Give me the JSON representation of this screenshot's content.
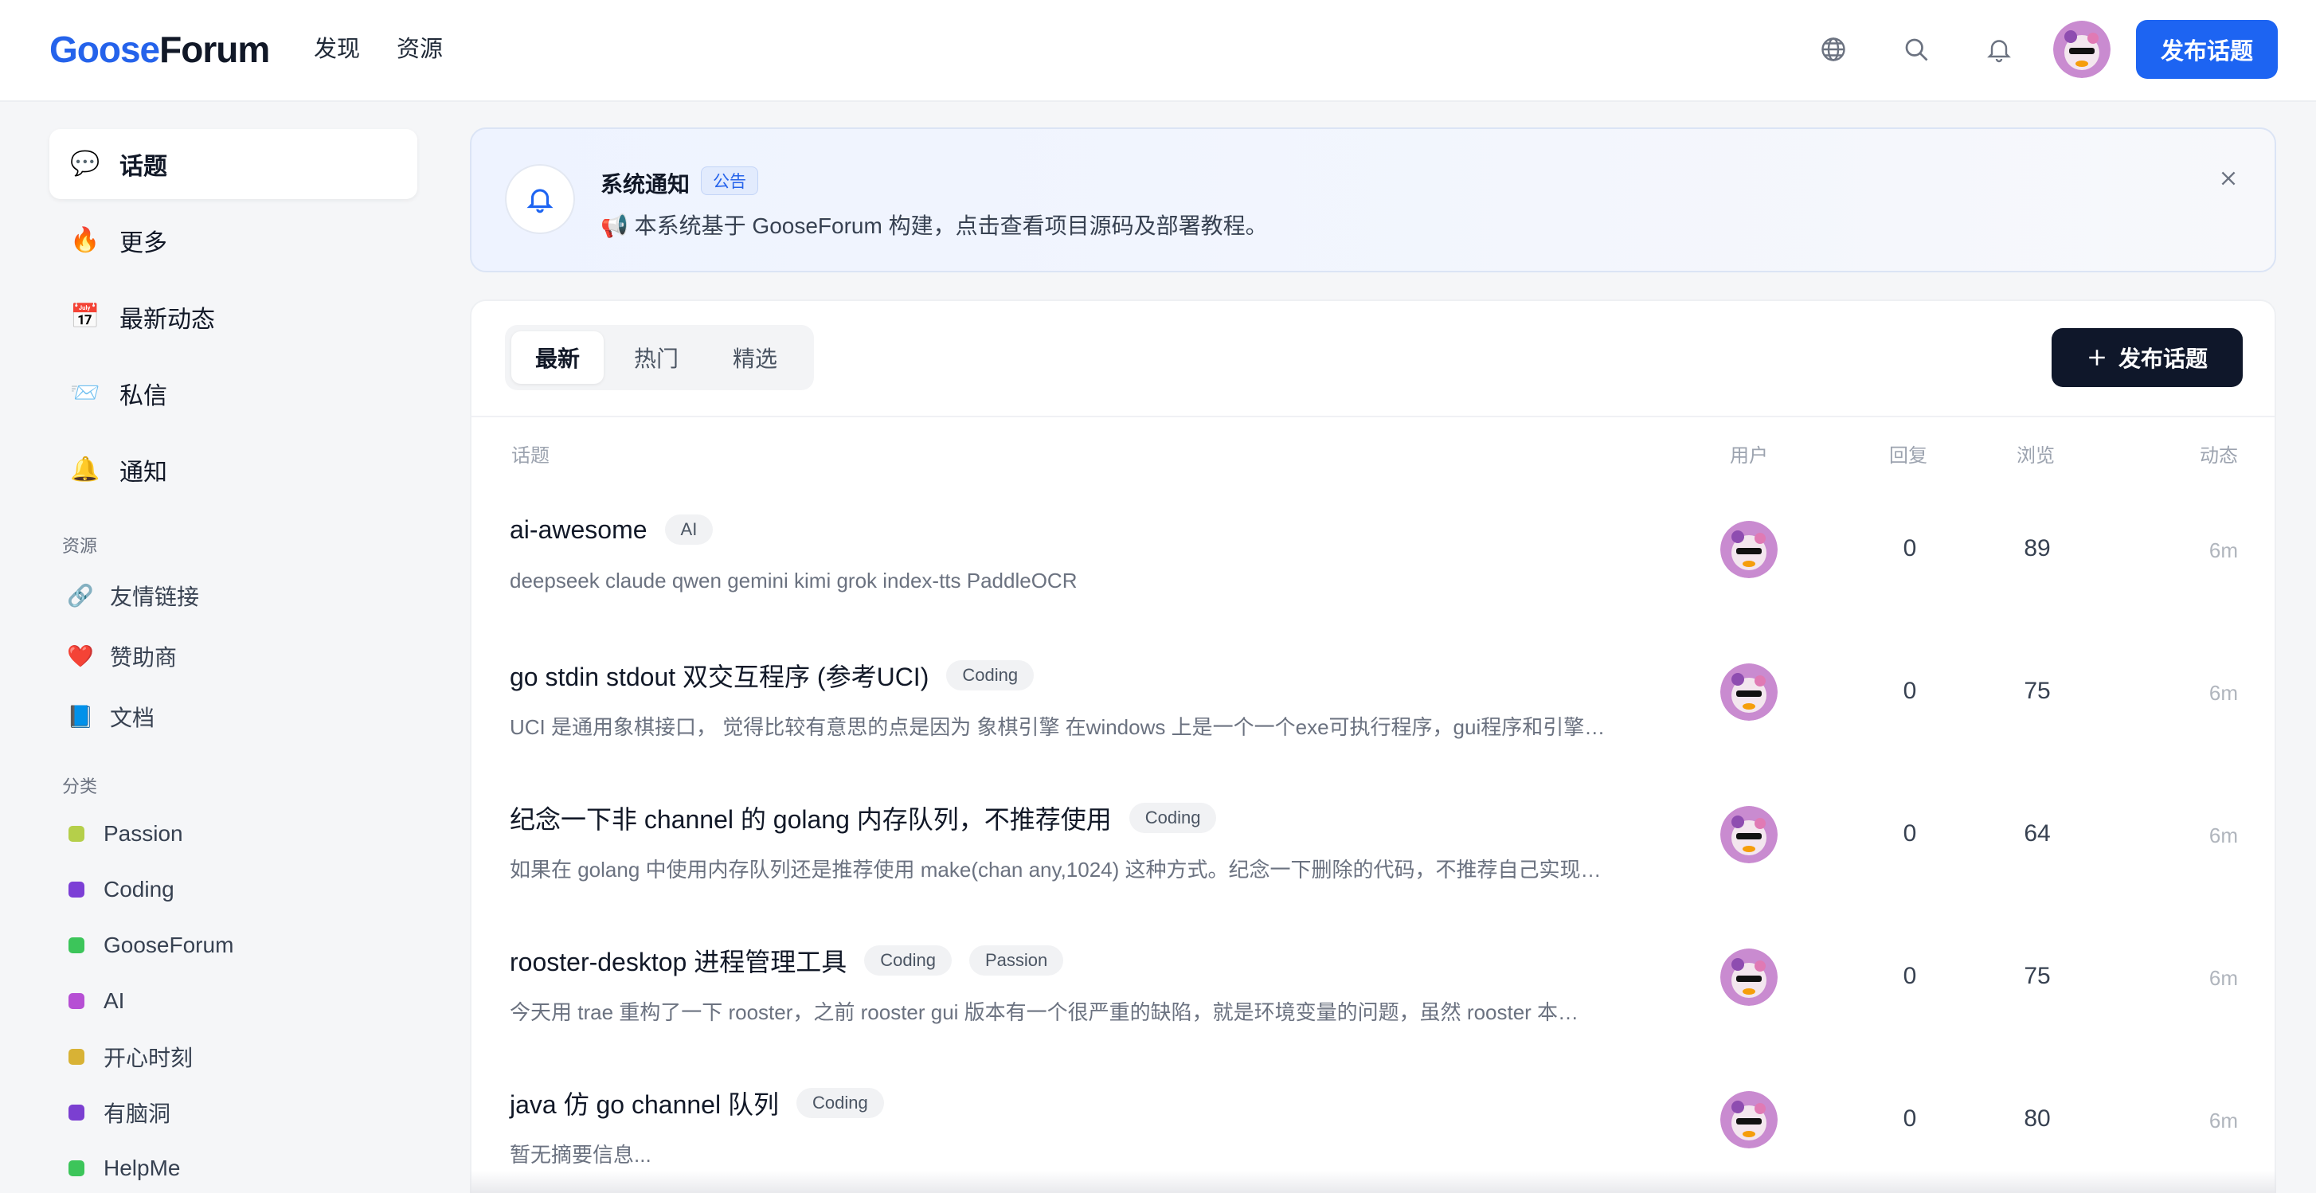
{
  "header": {
    "logo": {
      "part1": "Goose",
      "part2": "Forum"
    },
    "nav": [
      "发现",
      "资源"
    ],
    "icons": [
      "globe-icon",
      "search-icon",
      "bell-icon"
    ],
    "publish_label": "发布话题"
  },
  "sidebar": {
    "main": [
      {
        "emoji": "💬",
        "label": "话题",
        "active": true
      },
      {
        "emoji": "🔥",
        "label": "更多",
        "active": false
      },
      {
        "emoji": "📅",
        "label": "最新动态",
        "active": false
      },
      {
        "emoji": "📨",
        "label": "私信",
        "active": false
      },
      {
        "emoji": "🔔",
        "label": "通知",
        "active": false
      }
    ],
    "resources_title": "资源",
    "resources": [
      {
        "emoji": "🔗",
        "label": "友情链接"
      },
      {
        "emoji": "❤️",
        "label": "赞助商"
      },
      {
        "emoji": "📘",
        "label": "文档"
      }
    ],
    "categories_title": "分类",
    "categories": [
      {
        "label": "Passion",
        "color": "#b5cf4a"
      },
      {
        "label": "Coding",
        "color": "#7c3fd6"
      },
      {
        "label": "GooseForum",
        "color": "#3cc55a"
      },
      {
        "label": "AI",
        "color": "#b64fd4"
      },
      {
        "label": "开心时刻",
        "color": "#d8b235"
      },
      {
        "label": "有脑洞",
        "color": "#7b3fd1"
      },
      {
        "label": "HelpMe",
        "color": "#3cc55a"
      }
    ]
  },
  "notice": {
    "title": "系统通知",
    "badge": "公告",
    "text": "📢 本系统基于 GooseForum 构建，点击查看项目源码及部署教程。"
  },
  "topics": {
    "tabs": [
      "最新",
      "热门",
      "精选"
    ],
    "active_tab": "最新",
    "publish_label": "发布话题",
    "columns": {
      "topic": "话题",
      "user": "用户",
      "replies": "回复",
      "views": "浏览",
      "activity": "动态"
    },
    "rows": [
      {
        "title": "ai-awesome",
        "tags": [
          "AI"
        ],
        "summary": "deepseek claude qwen gemini kimi grok index-tts PaddleOCR",
        "replies": "0",
        "views": "89",
        "time": "6m"
      },
      {
        "title": "go stdin stdout 双交互程序 (参考UCI)",
        "tags": [
          "Coding"
        ],
        "summary": "UCI 是通用象棋接口， 觉得比较有意思的点是因为 象棋引擎 在windows 上是一个一个exe可执行程序，gui程序和引擎…",
        "replies": "0",
        "views": "75",
        "time": "6m"
      },
      {
        "title": "纪念一下非 channel 的 golang 内存队列，不推荐使用",
        "tags": [
          "Coding"
        ],
        "summary": "如果在 golang 中使用内存队列还是推荐使用 make(chan any,1024) 这种方式。纪念一下删除的代码，不推荐自己实现…",
        "replies": "0",
        "views": "64",
        "time": "6m"
      },
      {
        "title": "rooster-desktop 进程管理工具",
        "tags": [
          "Coding",
          "Passion"
        ],
        "summary": "今天用 trae 重构了一下 rooster，之前 rooster gui 版本有一个很严重的缺陷，就是环境变量的问题，虽然 rooster 本…",
        "replies": "0",
        "views": "75",
        "time": "6m"
      },
      {
        "title": "java 仿 go channel 队列",
        "tags": [
          "Coding"
        ],
        "summary": "暂无摘要信息...",
        "replies": "0",
        "views": "80",
        "time": "6m"
      }
    ]
  },
  "colors": {
    "primary": "#1d64f2",
    "dark_button": "#0f172a",
    "page_bg": "#f5f6f8"
  }
}
